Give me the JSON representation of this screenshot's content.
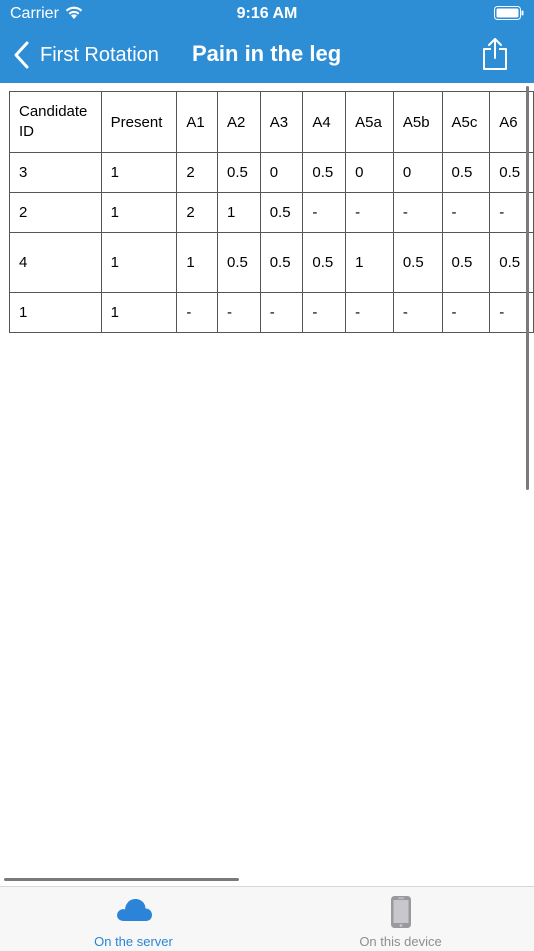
{
  "status_bar": {
    "carrier": "Carrier",
    "time": "9:16 AM"
  },
  "nav": {
    "back_label": "First Rotation",
    "title": "Pain in the leg"
  },
  "table": {
    "headers": [
      "Candidate ID",
      "Present",
      "A1",
      "A2",
      "A3",
      "A4",
      "A5a",
      "A5b",
      "A5c",
      "A6"
    ],
    "rows": [
      [
        "3",
        "1",
        "2",
        "0.5",
        "0",
        "0.5",
        "0",
        "0",
        "0.5",
        "0.5"
      ],
      [
        "2",
        "1",
        "2",
        "1",
        "0.5",
        "-",
        "-",
        "-",
        "-",
        "-"
      ],
      [
        "4",
        "1",
        "1",
        "0.5",
        "0.5",
        "0.5",
        "1",
        "0.5",
        "0.5",
        "0.5"
      ],
      [
        "1",
        "1",
        "-",
        "-",
        "-",
        "-",
        "-",
        "-",
        "-",
        "-"
      ]
    ]
  },
  "tabs": [
    {
      "label": "On the server",
      "icon": "cloud-icon",
      "active": true
    },
    {
      "label": "On this device",
      "icon": "phone-icon",
      "active": false
    }
  ],
  "colors": {
    "nav_blue": "#2d8ed6",
    "active_tab": "#2b84d8",
    "inactive_tab": "#8e8e93"
  }
}
